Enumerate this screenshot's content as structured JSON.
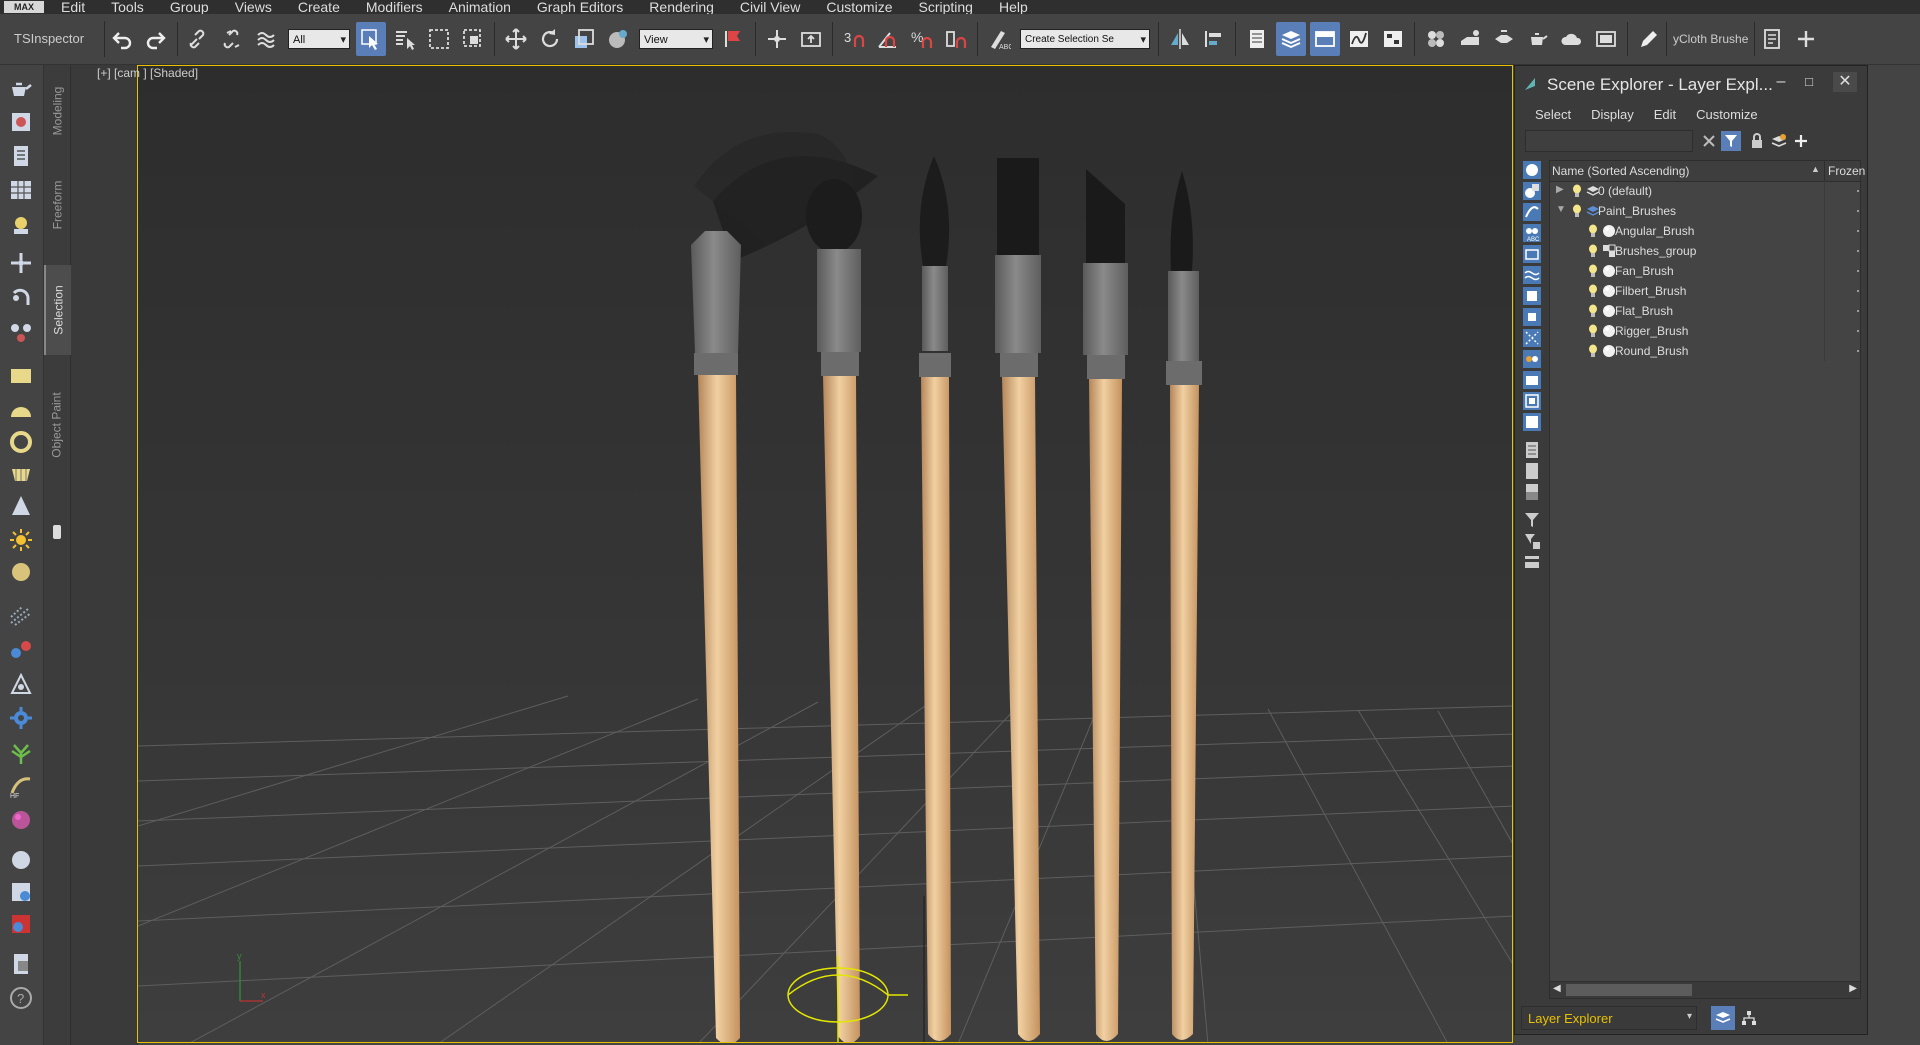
{
  "app": {
    "logo_text": "MAX",
    "menu": [
      "Edit",
      "Tools",
      "Group",
      "Views",
      "Create",
      "Modifiers",
      "Animation",
      "Graph Editors",
      "Rendering",
      "Civil View",
      "Customize",
      "Scripting",
      "Help"
    ]
  },
  "toolbar": {
    "inspector_label": "TSInspector",
    "selection_filter": "All",
    "reference_coord": "View",
    "named_selection_placeholder": "Create Selection Se",
    "snap_angle_label": "3",
    "cloth_label": "yCloth Brushe"
  },
  "ribbon_tabs": [
    "Modeling",
    "Freeform",
    "Selection",
    "Object Paint"
  ],
  "ribbon_active": "Selection",
  "viewport": {
    "label": "[+] [cam ] [Shaded]",
    "axis_x": "x",
    "axis_y": "y",
    "colors": {
      "border": "#e8c200",
      "handle": "#e2e600",
      "ferrule": "#767676",
      "wood": "#e3b586",
      "bristle": "#1c1c1c"
    }
  },
  "scene_explorer": {
    "title": "Scene Explorer - Layer Expl...",
    "menu": [
      "Select",
      "Display",
      "Edit",
      "Customize"
    ],
    "search_value": "",
    "columns": {
      "name": "Name (Sorted Ascending)",
      "frozen": "Frozen"
    },
    "tree": [
      {
        "label": "0 (default)",
        "level": 0,
        "type": "layer",
        "expanded": false
      },
      {
        "label": "Paint_Brushes",
        "level": 0,
        "type": "layer",
        "expanded": true
      },
      {
        "label": "Angular_Brush",
        "level": 1,
        "type": "object"
      },
      {
        "label": "Brushes_group",
        "level": 1,
        "type": "group"
      },
      {
        "label": "Fan_Brush",
        "level": 1,
        "type": "object"
      },
      {
        "label": "Filbert_Brush",
        "level": 1,
        "type": "object"
      },
      {
        "label": "Flat_Brush",
        "level": 1,
        "type": "object"
      },
      {
        "label": "Rigger_Brush",
        "level": 1,
        "type": "object"
      },
      {
        "label": "Round_Brush",
        "level": 1,
        "type": "object"
      }
    ],
    "explorer_type": "Layer Explorer"
  }
}
